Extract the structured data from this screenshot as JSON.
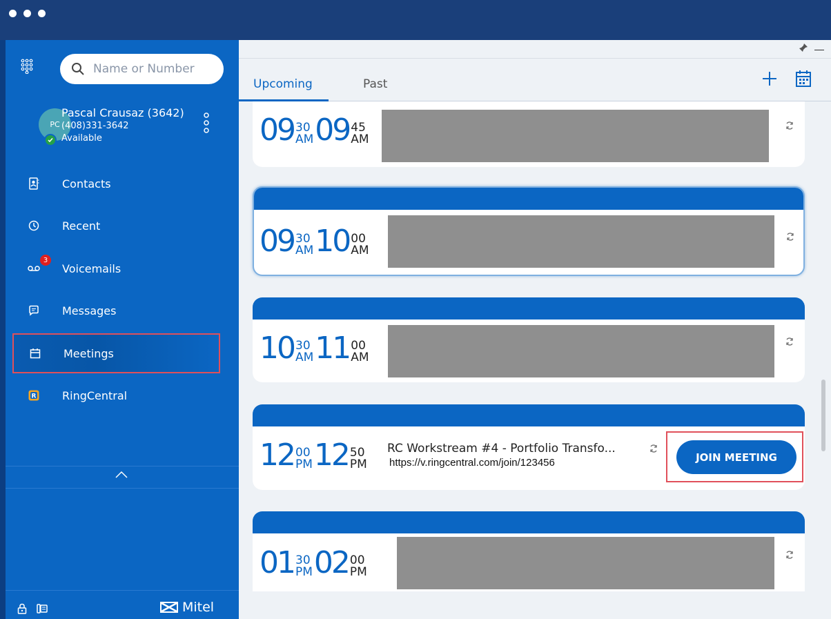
{
  "search": {
    "placeholder": "Name or Number"
  },
  "user": {
    "initials": "PC",
    "name": "Pascal Crausaz (3642)",
    "extension": "(408)331-3642",
    "status": "Available"
  },
  "sidebar": {
    "items": [
      {
        "label": "Contacts",
        "icon": "contacts-icon"
      },
      {
        "label": "Recent",
        "icon": "clock-icon"
      },
      {
        "label": "Voicemails",
        "icon": "voicemail-icon",
        "badge": "3"
      },
      {
        "label": "Messages",
        "icon": "message-icon"
      },
      {
        "label": "Meetings",
        "icon": "calendar-icon",
        "selected": true
      },
      {
        "label": "RingCentral",
        "icon": "ringcentral-icon"
      }
    ]
  },
  "footer": {
    "brand": "Mitel"
  },
  "tabs": {
    "upcoming": "Upcoming",
    "past": "Past"
  },
  "meetings": [
    {
      "start_hour": "09",
      "start_min": "30",
      "start_ampm": "AM",
      "end_hour": "09",
      "end_min": "45",
      "end_ampm": "AM"
    },
    {
      "start_hour": "09",
      "start_min": "30",
      "start_ampm": "AM",
      "end_hour": "10",
      "end_min": "00",
      "end_ampm": "AM"
    },
    {
      "start_hour": "10",
      "start_min": "30",
      "start_ampm": "AM",
      "end_hour": "11",
      "end_min": "00",
      "end_ampm": "AM"
    },
    {
      "start_hour": "12",
      "start_min": "00",
      "start_ampm": "PM",
      "end_hour": "12",
      "end_min": "50",
      "end_ampm": "PM",
      "title": "RC Workstream #4 - Portfolio Transfo...",
      "link": "https://v.ringcentral.com/join/123456",
      "join_label": "JOIN MEETING"
    },
    {
      "start_hour": "01",
      "start_min": "30",
      "start_ampm": "PM",
      "end_hour": "02",
      "end_min": "00",
      "end_ampm": "PM"
    }
  ],
  "colors": {
    "accent": "#0b66c3",
    "titlebar": "#1a3f7a",
    "highlight_border": "#e0505a",
    "background": "#eef2f6"
  }
}
